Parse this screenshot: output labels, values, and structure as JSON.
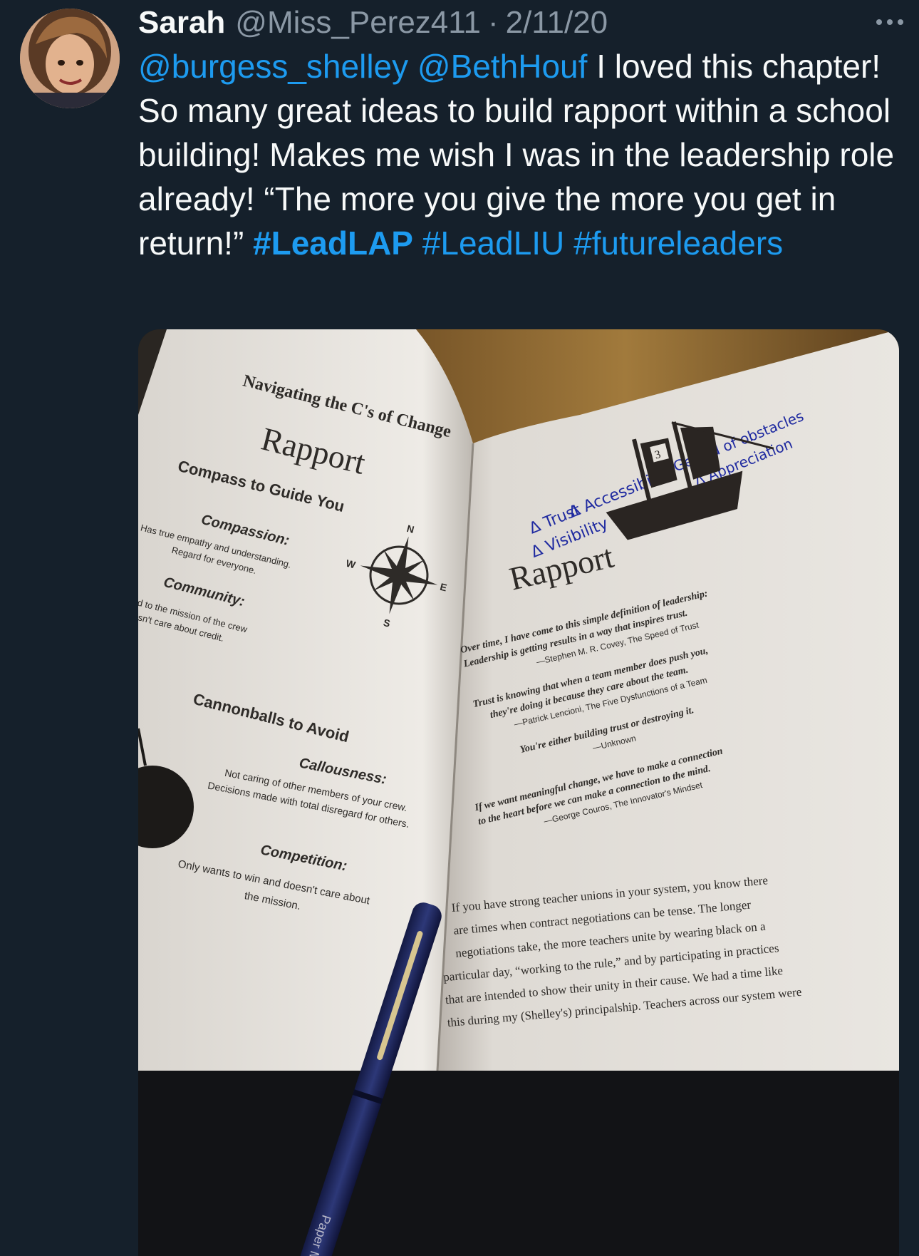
{
  "user": {
    "display_name": "Sarah",
    "handle": "@Miss_Perez411",
    "separator": "·",
    "date": "2/11/20"
  },
  "tweet": {
    "mention_1": "@burgess_shelley",
    "mention_2": "@BethHouf",
    "text": "I loved this chapter! So many great ideas to build rapport within a school building! Makes me wish I was in the leadership role already! “The more you give the more you get in return!”",
    "hashtag_1": "#LeadLAP",
    "hashtag_2": "#LeadLIU",
    "hashtag_3": "#futureleaders"
  },
  "photo": {
    "left_page": {
      "running_head": "Navigating the C's of Change",
      "title": "Rapport",
      "compass_heading": "Compass to Guide You",
      "compassion_label": "Compassion:",
      "compassion_line1": "Has true empathy and understanding.",
      "compassion_line2": "Regard for everyone.",
      "community_label": "Community:",
      "community_line1": "Dedicated to the mission of the crew",
      "community_line2": "and doesn't care about credit.",
      "cannonballs_heading": "Cannonballs to Avoid",
      "callousness_label": "Callousness:",
      "callousness_line1": "Not caring of other members of your crew.",
      "callousness_line2": "Decisions made with total disregard for others.",
      "competition_label": "Competition:",
      "competition_line1": "Only wants to win and doesn't care about",
      "competition_line2": "the mission.",
      "compass_n": "N",
      "compass_s": "S",
      "compass_e": "E",
      "compass_w": "W"
    },
    "right_page": {
      "ship_number": "3",
      "title": "Rapport",
      "handwritten": [
        "Δ Trust",
        "Δ Visibility",
        "Δ Accessibility",
        "Δ Get rid of obstacles",
        "Δ Appreciation"
      ],
      "quotes": [
        {
          "l1": "Over time, I have come to this simple definition of leadership:",
          "l2": "Leadership is getting results in a way that inspires trust.",
          "attr": "—Stephen M. R. Covey, The Speed of Trust"
        },
        {
          "l1": "Trust is knowing that when a team member does push you,",
          "l2": "they're doing it because they care about the team.",
          "attr": "—Patrick Lencioni, The Five Dysfunctions of a Team"
        },
        {
          "l1": "You're either building trust or destroying it.",
          "l2": "",
          "attr": "—Unknown"
        },
        {
          "l1": "If we want meaningful change, we have to make a connection",
          "l2": "to the heart before we can make a connection to the mind.",
          "attr": "—George Couros, The Innovator's Mindset"
        }
      ],
      "body_lines": [
        "If you have strong teacher unions in your system, you know there",
        "are times when contract negotiations can be tense. The longer",
        "negotiations take, the more teachers unite by wearing black on a",
        "particular day, “working to the rule,” and by participating in practices",
        "that are intended to show their unity in their cause. We had a time like",
        "this during my (Shelley's) principalship. Teachers across our system were"
      ]
    },
    "pen_brand": "Paper Mate"
  }
}
